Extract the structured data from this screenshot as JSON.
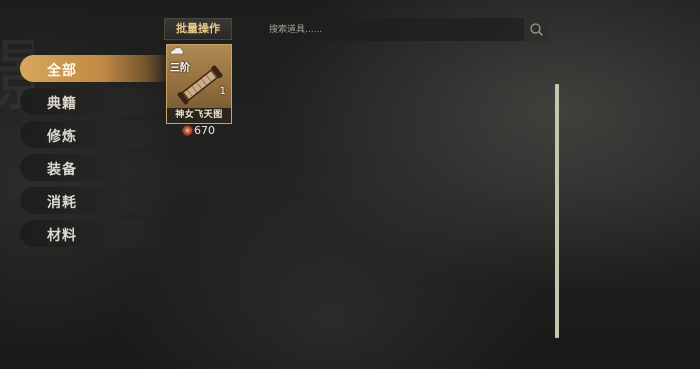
{
  "background": {
    "glyph": "影"
  },
  "sidebar": {
    "active_index": 0,
    "items": [
      {
        "label": "全部"
      },
      {
        "label": "典籍"
      },
      {
        "label": "修炼"
      },
      {
        "label": "装备"
      },
      {
        "label": "消耗"
      },
      {
        "label": "材料"
      }
    ]
  },
  "toolbar": {
    "batch_label": "批量操作",
    "search_placeholder": "搜索道具......",
    "search_icon": "search-icon"
  },
  "items": [
    {
      "tier": "三阶",
      "quantity": "1",
      "name": "神女飞天图",
      "price": "670",
      "icon": "scroll-icon",
      "currency_icon": "coin-icon"
    }
  ],
  "colors": {
    "accent": "#c8964f",
    "card_bg": "#9b7848",
    "text": "#e8e4d8",
    "scrollbar": "#c8c4ad"
  }
}
